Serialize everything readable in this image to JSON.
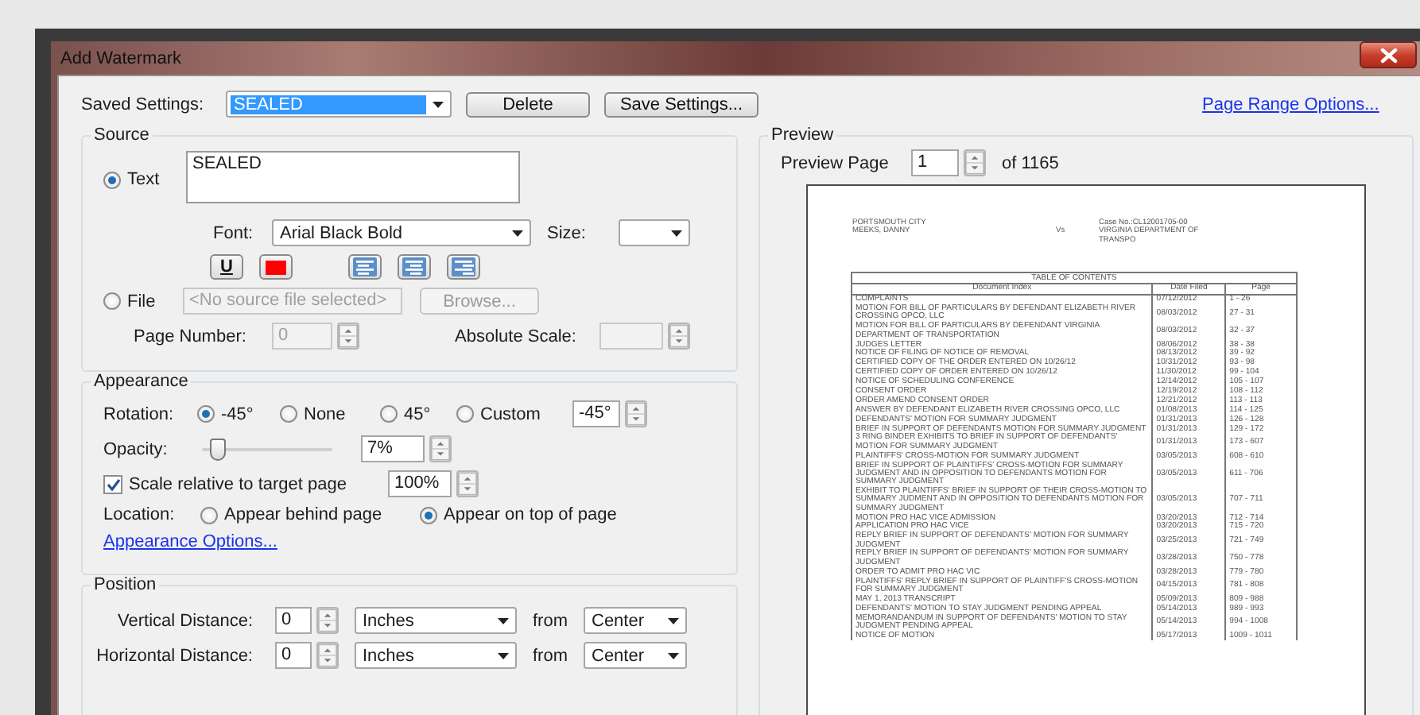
{
  "window": {
    "title": "Add Watermark"
  },
  "saved_settings": {
    "label": "Saved Settings:",
    "value": "SEALED",
    "buttons": [
      "Delete",
      "Save Settings..."
    ]
  },
  "page_range_link": "Page Range Options...",
  "source": {
    "title": "Source",
    "options": [
      {
        "kind": "text",
        "label": "Text",
        "selected": true,
        "value": "SEALED"
      },
      {
        "kind": "file",
        "label": "File",
        "selected": false,
        "disabled": true,
        "value": "<No source file selected>",
        "button": "Browse..."
      }
    ],
    "font": {
      "label": "Font:",
      "value": "Arial Black Bold"
    },
    "size": {
      "label": "Size:"
    },
    "underline": "U",
    "page_number": {
      "label": "Page Number:",
      "value": "0",
      "disabled": true
    },
    "absolute_scale": {
      "label": "Absolute Scale:"
    }
  },
  "appearance": {
    "title": "Appearance",
    "rotation": {
      "label": "Rotation:",
      "options": [
        {
          "label": "-45°",
          "selected": true
        },
        {
          "label": "None",
          "selected": false
        },
        {
          "label": "45°",
          "selected": false
        },
        {
          "label": "Custom",
          "selected": false
        }
      ],
      "custom_value": "-45°"
    },
    "opacity": {
      "label": "Opacity:",
      "level": 0.07,
      "value": "7%"
    },
    "scale": {
      "label": "Scale relative to target page",
      "checked": true,
      "value": "100%"
    },
    "location": {
      "label": "Location:",
      "options": [
        {
          "label": "Appear behind page",
          "selected": false
        },
        {
          "label": "Appear on top of page",
          "selected": true
        }
      ]
    },
    "options_link": "Appearance Options..."
  },
  "position": {
    "title": "Position",
    "rows": [
      {
        "label": "Vertical Distance:",
        "value": "0",
        "unit": "Inches",
        "from_label": "from",
        "anchor": "Center"
      },
      {
        "label": "Horizontal Distance:",
        "value": "0",
        "unit": "Inches",
        "from_label": "from",
        "anchor": "Center"
      }
    ]
  },
  "preview": {
    "title": "Preview",
    "page_label": "Preview Page",
    "page": "1",
    "total": "of 1165",
    "document": {
      "header_left": [
        "PORTSMOUTH CITY",
        "MEEKS, DANNY"
      ],
      "versus": "Vs",
      "header_right": [
        "Case No.:CL12001705-00",
        "VIRGINIA DEPARTMENT OF TRANSPO"
      ],
      "toc_title": "TABLE OF CONTENTS",
      "columns": [
        "Document Index",
        "Date Filed",
        "Page"
      ],
      "rows": [
        {
          "document": "COMPLAINTS",
          "date": "07/12/2012",
          "pages": "1 - 26"
        },
        {
          "document": "MOTION FOR BILL OF PARTICULARS BY DEFENDANT ELIZABETH RIVER CROSSING OPCO, LLC",
          "date": "08/03/2012",
          "pages": "27 - 31"
        },
        {
          "document": "MOTION FOR BILL OF PARTICULARS BY DEFENDANT VIRGINIA DEPARTMENT OF TRANSPORTATION",
          "date": "08/03/2012",
          "pages": "32 - 37"
        },
        {
          "document": "JUDGES LETTER",
          "date": "08/06/2012",
          "pages": "38 - 38"
        },
        {
          "document": "NOTICE OF FILING OF NOTICE OF REMOVAL",
          "date": "08/13/2012",
          "pages": "39 - 92"
        },
        {
          "document": "CERTIFIED COPY OF THE ORDER ENTERED ON 10/26/12",
          "date": "10/31/2012",
          "pages": "93 - 98"
        },
        {
          "document": "CERTIFIED COPY OF ORDER ENTERED ON 10/26/12",
          "date": "11/30/2012",
          "pages": "99 - 104"
        },
        {
          "document": "NOTICE OF SCHEDULING CONFERENCE",
          "date": "12/14/2012",
          "pages": "105 - 107"
        },
        {
          "document": "CONSENT ORDER",
          "date": "12/19/2012",
          "pages": "108 - 112"
        },
        {
          "document": "ORDER AMEND CONSENT ORDER",
          "date": "12/21/2012",
          "pages": "113 - 113"
        },
        {
          "document": "ANSWER BY DEFENDANT ELIZABETH RIVER CROSSING OPCO, LLC",
          "date": "01/08/2013",
          "pages": "114 - 125"
        },
        {
          "document": "DEFENDANTS' MOTION FOR SUMMARY JUDGMENT",
          "date": "01/31/2013",
          "pages": "126 - 128"
        },
        {
          "document": "BRIEF IN SUPPORT OF DEFENDANTS MOTION FOR SUMMARY JUDGMENT",
          "date": "01/31/2013",
          "pages": "129 - 172"
        },
        {
          "document": "3 RING BINDER EXHIBITS TO BRIEF IN SUPPORT OF DEFENDANTS' MOTION FOR SUMMARY JUDGMENT",
          "date": "01/31/2013",
          "pages": "173 - 607"
        },
        {
          "document": "PLAINTIFFS' CROSS-MOTION FOR SUMMARY JUDGMENT",
          "date": "03/05/2013",
          "pages": "608 - 610"
        },
        {
          "document": "BRIEF IN SUPPORT OF PLAINTIFFS' CROSS-MOTION FOR SUMMARY JUDGMENT AND IN OPPOSITION TO DEFENDANTS MOTION FOR SUMMARY JUDGMENT",
          "date": "03/05/2013",
          "pages": "611 - 706"
        },
        {
          "document": "EXHIBIT TO PLAINTIFFS' BRIEF IN SUPPORT OF THEIR CROSS-MOTION TO SUMMARY JUDMENT AND IN OPPOSITION TO DEFENDANTS MOTION FOR SUMMARY JUDGMENT",
          "date": "03/05/2013",
          "pages": "707 - 711"
        },
        {
          "document": "MOTION PRO HAC VICE ADMISSION",
          "date": "03/20/2013",
          "pages": "712 - 714"
        },
        {
          "document": "APPLICATION PRO HAC VICE",
          "date": "03/20/2013",
          "pages": "715 - 720"
        },
        {
          "document": "REPLY BRIEF IN SUPPORT OF DEFENDANTS' MOTION FOR SUMMARY JUDGMENT",
          "date": "03/25/2013",
          "pages": "721 - 749"
        },
        {
          "document": "REPLY BRIEF IN SUPPORT OF DEFENDANTS' MOTION FOR SUMMARY JUDGMENT",
          "date": "03/28/2013",
          "pages": "750 - 778"
        },
        {
          "document": "ORDER TO ADMIT PRO HAC VIC",
          "date": "03/28/2013",
          "pages": "779 - 780"
        },
        {
          "document": "PLAINTIFFS' REPLY BRIEF IN SUPPORT OF PLAINTIFF'S CROSS-MOTION FOR SUMMARY JUDGMENT",
          "date": "04/15/2013",
          "pages": "781 - 808"
        },
        {
          "document": "MAY 1, 2013 TRANSCRIPT",
          "date": "05/09/2013",
          "pages": "809 - 988"
        },
        {
          "document": "DEFENDANTS' MOTION TO STAY JUDGMENT PENDING APPEAL",
          "date": "05/14/2013",
          "pages": "989 - 993"
        },
        {
          "document": "MEMORANDANDUM IN SUPPORT OF DEFENDANTS' MOTION TO STAY JUDGMENT PENDING APPEAL",
          "date": "05/14/2013",
          "pages": "994 - 1008"
        },
        {
          "document": "NOTICE OF MOTION",
          "date": "05/17/2013",
          "pages": "1009 - 1011"
        }
      ]
    }
  }
}
